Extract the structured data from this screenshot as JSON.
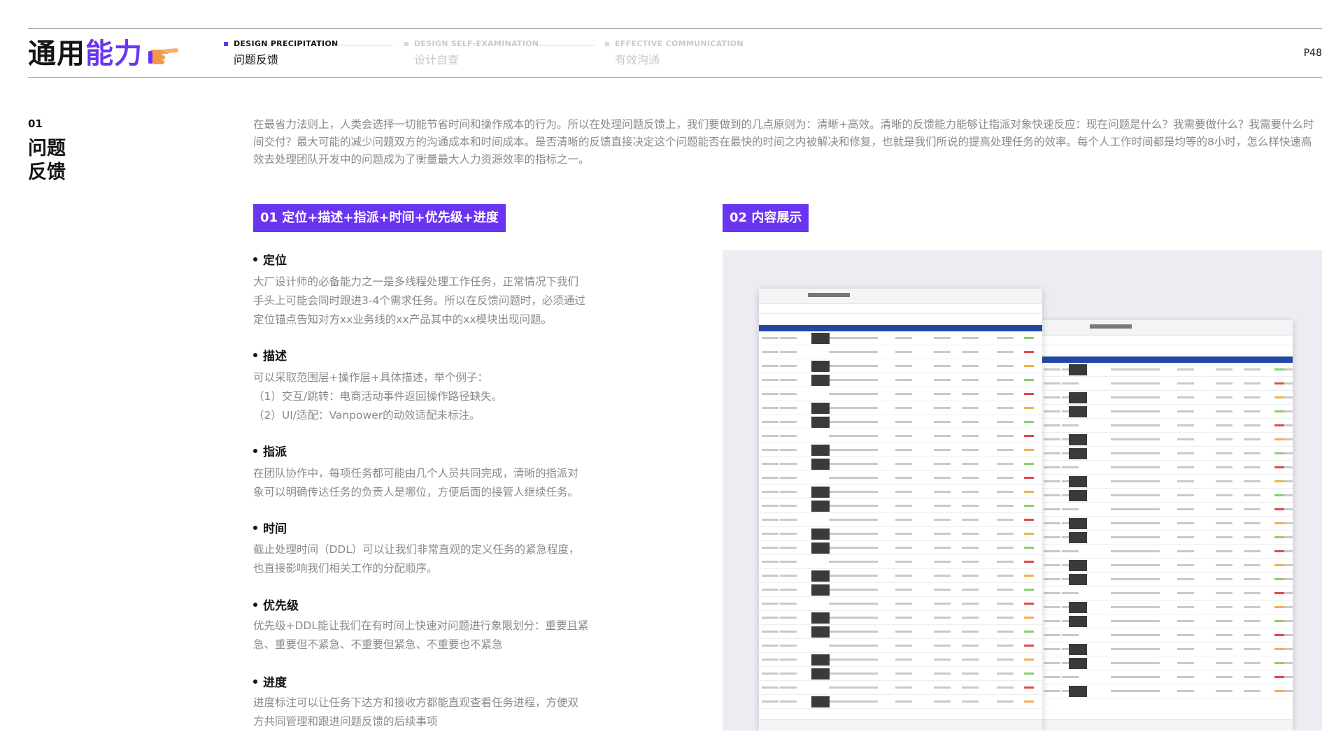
{
  "header": {
    "title_part1": "通用",
    "title_part2": "能力",
    "title_icon": "pointing-hand-icon",
    "steps": [
      {
        "en": "DESIGN PRECIPITATION",
        "zh": "问题反馈",
        "active": true
      },
      {
        "en": "DESIGN SELF-EXAMINATION",
        "zh": "设计自查",
        "active": false
      },
      {
        "en": "EFFECTIVE COMMUNICATION",
        "zh": "有效沟通",
        "active": false
      }
    ],
    "page_number": "P48"
  },
  "section": {
    "number": "01",
    "title_line1": "问题",
    "title_line2": "反馈",
    "intro": "在最省力法则上，人类会选择一切能节省时间和操作成本的行为。所以在处理问题反馈上，我们要做到的几点原则为：清晰+高效。清晰的反馈能力能够让指派对象快速反应：现在问题是什么？我需要做什么？我需要什么时间交付？最大可能的减少问题双方的沟通成本和时间成本。是否清晰的反馈直接决定这个问题能否在最快的时间之内被解决和修复，也就是我们所说的提高处理任务的效率。每个人工作时间都是均等的8小时，怎么样快速高效去处理团队开发中的问题成为了衡量最大人力资源效率的指标之一。"
  },
  "tags": {
    "left": "01  定位+描述+指派+时间+优先级+进度",
    "right": "02  内容展示"
  },
  "items": [
    {
      "heading": "定位",
      "lines": [
        "大厂设计师的必备能力之一是多线程处理工作任务，正常情况下我们",
        "手头上可能会同时跟进3-4个需求任务。所以在反馈问题时，必须通过",
        "定位锚点告知对方xx业务线的xx产品其中的xx模块出现问题。"
      ]
    },
    {
      "heading": "描述",
      "lines": [
        "可以采取范围层+操作层+具体描述，举个例子：",
        "（1）交互/跳转：电商活动事件返回操作路径缺失。",
        "（2）UI/适配：Vanpower的动效适配未标注。"
      ]
    },
    {
      "heading": "指派",
      "lines": [
        "在团队协作中，每项任务都可能由几个人员共同完成，清晰的指派对",
        "象可以明确传达任务的负责人是哪位，方便后面的接管人继续任务。"
      ]
    },
    {
      "heading": "时间",
      "lines": [
        "截止处理时间（DDL）可以让我们非常直观的定义任务的紧急程度，",
        "也直接影响我们相关工作的分配顺序。"
      ]
    },
    {
      "heading": "优先级",
      "lines": [
        "优先级+DDL能让我们在有时间上快速对问题进行象限划分：重要且紧",
        "急、重要但不紧急、不重要但紧急、不重要也不紧急"
      ]
    },
    {
      "heading": "进度",
      "lines": [
        "进度标注可以让任务下达方和接收方都能直观查看任务进程，方便双",
        "方共同管理和跟进问题反馈的后续事项"
      ]
    }
  ],
  "colors": {
    "accent": "#6a35f0",
    "text_dark": "#141414",
    "text_muted": "#8a8a8a",
    "table_header": "#2447a6"
  }
}
